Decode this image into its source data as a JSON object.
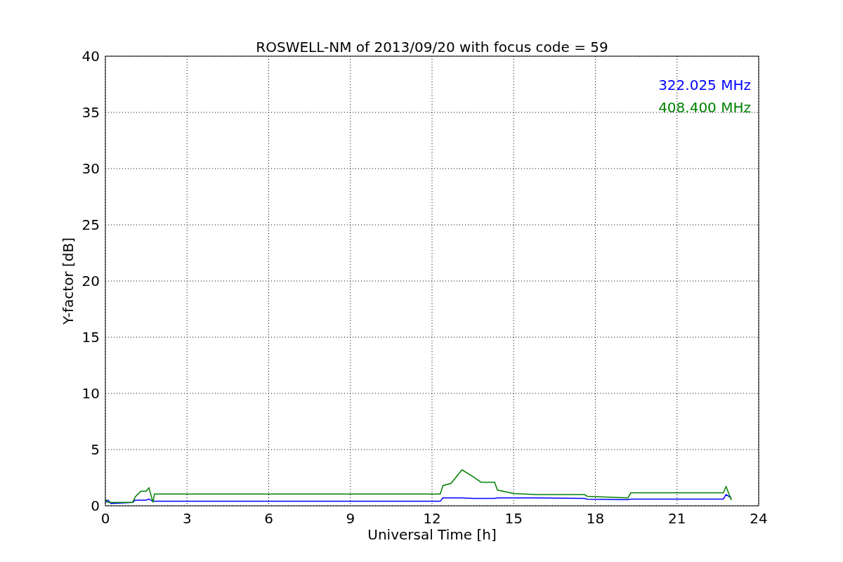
{
  "figure": {
    "chart_data": {
      "type": "line",
      "title": "ROSWELL-NM of 2013/09/20 with focus code = 59",
      "xlabel": "Universal Time [h]",
      "ylabel": "Y-factor [dB]",
      "x": [
        0,
        0.1,
        0.2,
        1.0,
        1.1,
        1.3,
        1.5,
        1.6,
        1.75,
        1.8,
        12.3,
        12.4,
        12.7,
        13.1,
        13.5,
        13.8,
        14.3,
        14.4,
        15.0,
        15.8,
        17.6,
        17.7,
        19.2,
        19.3,
        22.7,
        22.8,
        23.0
      ],
      "series": [
        {
          "name": "322.025 MHz",
          "color": "#0000ff",
          "values": [
            0.3,
            0.5,
            0.2,
            0.3,
            0.5,
            0.5,
            0.5,
            0.6,
            0.4,
            0.4,
            0.4,
            0.7,
            0.7,
            0.7,
            0.65,
            0.65,
            0.65,
            0.7,
            0.7,
            0.7,
            0.65,
            0.6,
            0.55,
            0.6,
            0.6,
            1.0,
            0.7
          ]
        },
        {
          "name": "408.400 MHz",
          "color": "#008000",
          "values": [
            0.6,
            0.3,
            0.3,
            0.3,
            0.8,
            1.3,
            1.3,
            1.6,
            0.3,
            1.05,
            1.05,
            1.8,
            2.0,
            3.2,
            2.6,
            2.1,
            2.1,
            1.4,
            1.1,
            1.0,
            1.0,
            0.85,
            0.7,
            1.15,
            1.15,
            1.7,
            0.5
          ]
        }
      ],
      "xlim": [
        0,
        24
      ],
      "ylim": [
        0,
        40
      ],
      "xticks": [
        0,
        3,
        6,
        9,
        12,
        15,
        18,
        21,
        24
      ],
      "yticks": [
        0,
        5,
        10,
        15,
        20,
        25,
        30,
        35,
        40
      ],
      "grid": true
    }
  }
}
